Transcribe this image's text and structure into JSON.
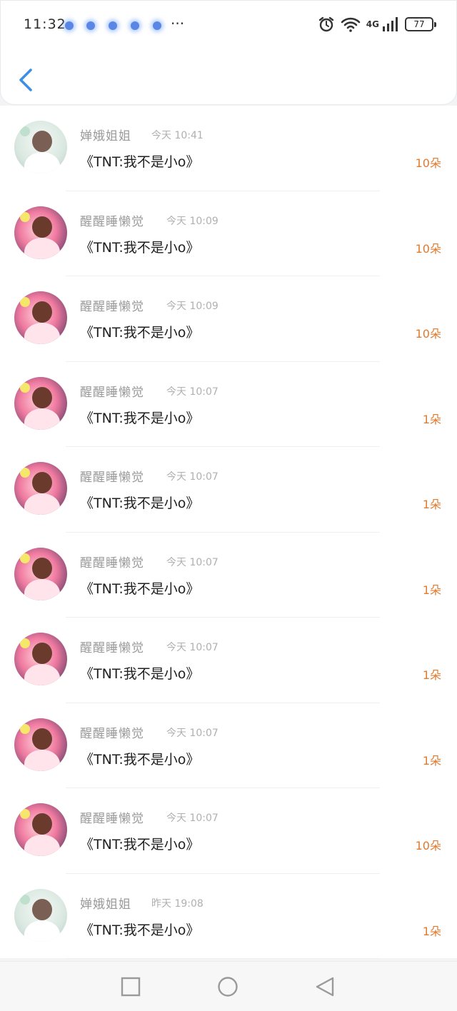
{
  "status_bar": {
    "time": "11:32",
    "battery": "77",
    "network": "4G",
    "more": "···"
  },
  "header": {
    "back_icon": "chevron-left-icon"
  },
  "colors": {
    "accent": "#3c8ee6",
    "count": "#e07a2e"
  },
  "items": [
    {
      "name": "婵娥姐姐",
      "time": "今天 10:41",
      "title": "《TNT:我不是小o》",
      "count": "10朵",
      "avatar": "a"
    },
    {
      "name": "醒醒睡懒觉",
      "time": "今天 10:09",
      "title": "《TNT:我不是小o》",
      "count": "10朵",
      "avatar": "b"
    },
    {
      "name": "醒醒睡懒觉",
      "time": "今天 10:09",
      "title": "《TNT:我不是小o》",
      "count": "10朵",
      "avatar": "b"
    },
    {
      "name": "醒醒睡懒觉",
      "time": "今天 10:07",
      "title": "《TNT:我不是小o》",
      "count": "1朵",
      "avatar": "b"
    },
    {
      "name": "醒醒睡懒觉",
      "time": "今天 10:07",
      "title": "《TNT:我不是小o》",
      "count": "1朵",
      "avatar": "b"
    },
    {
      "name": "醒醒睡懒觉",
      "time": "今天 10:07",
      "title": "《TNT:我不是小o》",
      "count": "1朵",
      "avatar": "b"
    },
    {
      "name": "醒醒睡懒觉",
      "time": "今天 10:07",
      "title": "《TNT:我不是小o》",
      "count": "1朵",
      "avatar": "b"
    },
    {
      "name": "醒醒睡懒觉",
      "time": "今天 10:07",
      "title": "《TNT:我不是小o》",
      "count": "1朵",
      "avatar": "b"
    },
    {
      "name": "醒醒睡懒觉",
      "time": "今天 10:07",
      "title": "《TNT:我不是小o》",
      "count": "10朵",
      "avatar": "b"
    },
    {
      "name": "婵娥姐姐",
      "time": "昨天 19:08",
      "title": "《TNT:我不是小o》",
      "count": "1朵",
      "avatar": "a"
    }
  ]
}
